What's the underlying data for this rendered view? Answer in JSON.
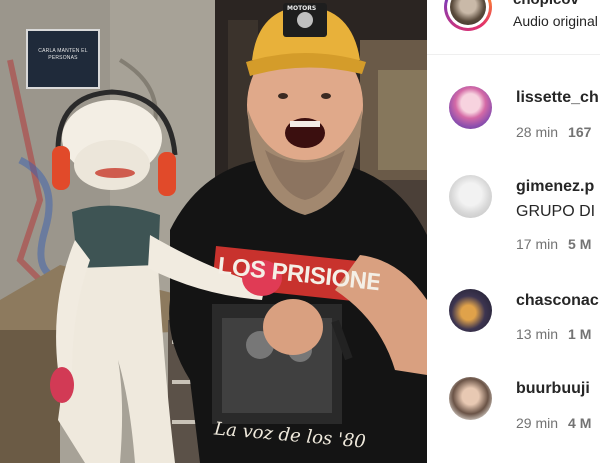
{
  "post": {
    "username": "chopicov",
    "audio_label": "Audio original",
    "sign_text": "CARLA MANTEN EL PERSONAS",
    "cap_text": "MOTORS",
    "shirt_band": "LOS PRISIONEROS",
    "shirt_script": "La voz de los '80"
  },
  "comments": [
    {
      "username": "lissette_ch",
      "text": "",
      "time": "28 min",
      "likes": "167"
    },
    {
      "username": "gimenez.p",
      "text": "GRUPO DI",
      "time": "17 min",
      "likes": "5 M"
    },
    {
      "username": "chasconac",
      "text": "",
      "time": "13 min",
      "likes": "1 M"
    },
    {
      "username": "buurbuuji",
      "text": "",
      "time": "29 min",
      "likes": "4 M"
    }
  ],
  "colors": {
    "text": "#262626",
    "secondary": "#737373",
    "cap_yellow": "#e8b13a",
    "shirt_red": "#c8322d"
  }
}
